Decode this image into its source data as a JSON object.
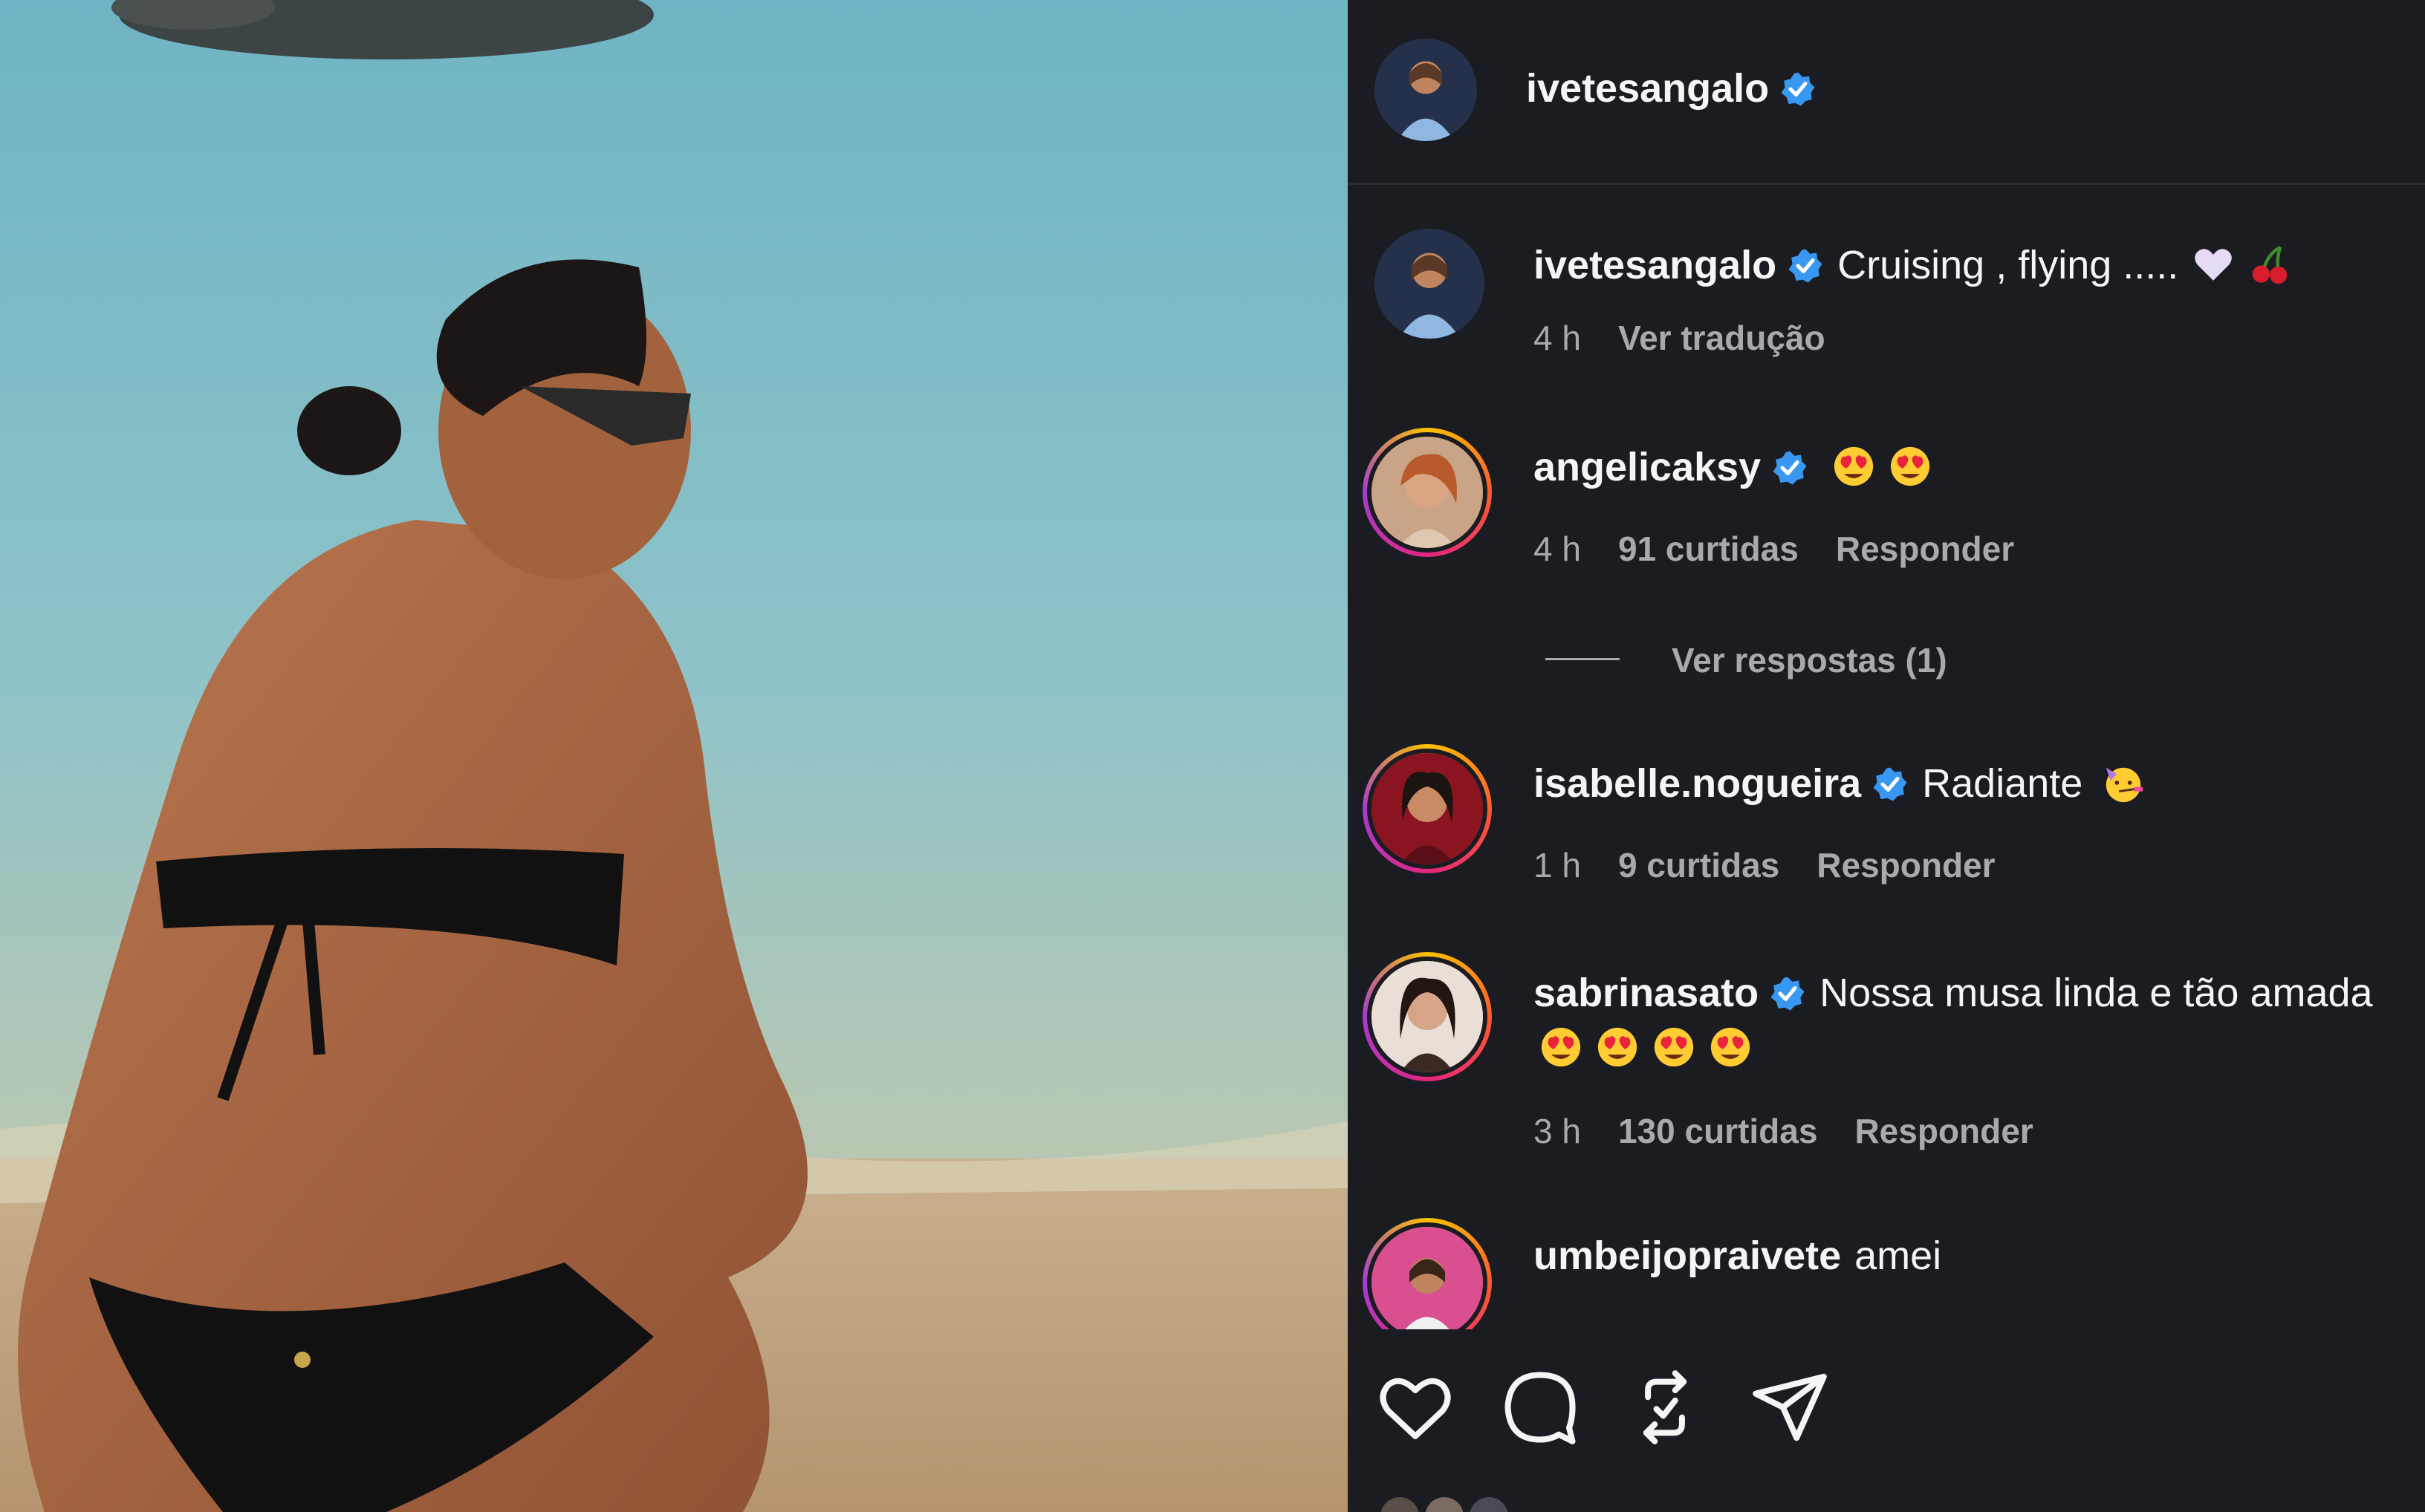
{
  "post": {
    "author": "ivetesangalo",
    "verified": true,
    "caption_author": "ivetesangalo",
    "caption_text": "Cruising , flying .....",
    "caption_emojis": [
      "white-heart",
      "cherries"
    ],
    "caption_time": "4 h",
    "translate_label": "Ver tradução"
  },
  "comments": [
    {
      "user": "angelicaksy",
      "verified": true,
      "text": "",
      "emojis": [
        "heart-eyes",
        "heart-eyes"
      ],
      "time": "4 h",
      "likes": "91 curtidas",
      "reply": "Responder"
    },
    {
      "user": "isabelle.nogueira",
      "verified": true,
      "text": "Radiante",
      "emojis": [
        "partying-face"
      ],
      "time": "1 h",
      "likes": "9 curtidas",
      "reply": "Responder"
    },
    {
      "user": "sabrinasato",
      "verified": true,
      "text": "Nossa musa linda e tão amada",
      "emojis": [
        "heart-eyes",
        "heart-eyes",
        "heart-eyes",
        "heart-eyes"
      ],
      "time": "3 h",
      "likes": "130 curtidas",
      "reply": "Responder"
    },
    {
      "user": "umbeijopraivete",
      "verified": false,
      "text": "amei"
    }
  ],
  "view_replies": "Ver respostas (1)",
  "actions": [
    "heart-icon",
    "comment-icon",
    "repost-icon",
    "share-icon"
  ],
  "colors": {
    "panel_bg": "#1b1c21",
    "verified_blue": "#3897f0",
    "muted_text": "#a8a8ad"
  }
}
